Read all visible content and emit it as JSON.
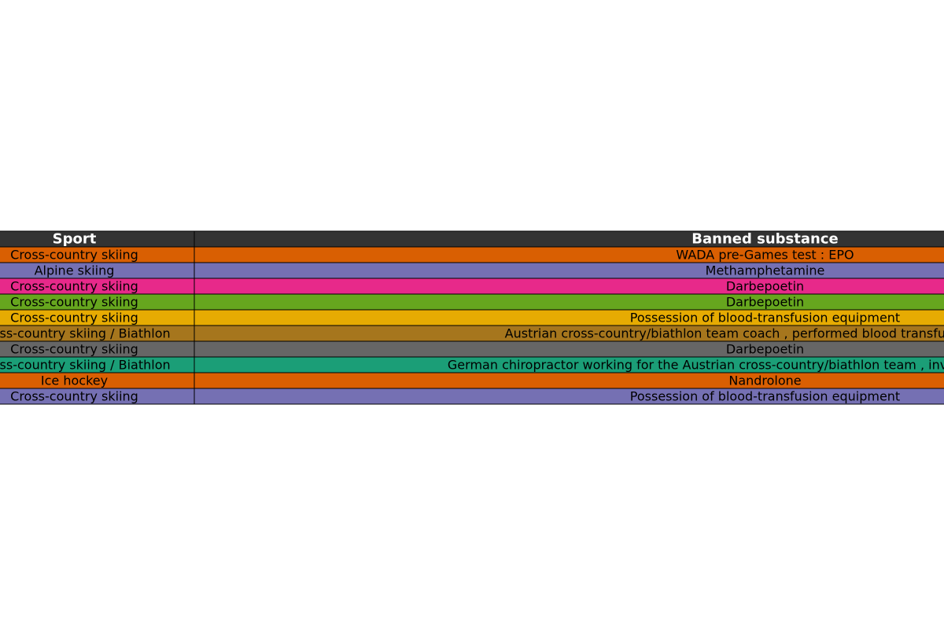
{
  "chart_data": {
    "type": "table",
    "columns": [
      "Sport",
      "Banned substance"
    ],
    "rows": [
      [
        "Cross-country skiing",
        "WADA pre-Games test : EPO"
      ],
      [
        "Alpine skiing",
        "Methamphetamine"
      ],
      [
        "Cross-country skiing",
        "Darbepoetin"
      ],
      [
        "Cross-country skiing",
        "Darbepoetin"
      ],
      [
        "Cross-country skiing",
        "Possession of blood-transfusion equipment"
      ],
      [
        "Cross-country skiing / Biathlon",
        "Austrian cross-country/biathlon team coach , performed blood transfusions on Mar"
      ],
      [
        "Cross-country skiing",
        "Darbepoetin"
      ],
      [
        "Cross-country skiing / Biathlon",
        "German chiropractor working for the Austrian cross-country/biathlon team , involved in the blood tra"
      ],
      [
        "Ice hockey",
        "Nandrolone"
      ],
      [
        "Cross-country skiing",
        "Possession of blood-transfusion equipment"
      ]
    ],
    "header_color": "#333333",
    "header_text_color": "#ffffff",
    "row_colors": [
      "#d95f02",
      "#7570b3",
      "#e7298a",
      "#66a61e",
      "#e6ab02",
      "#a6761d",
      "#666666",
      "#1b9e77",
      "#d95f02",
      "#7570b3"
    ]
  }
}
